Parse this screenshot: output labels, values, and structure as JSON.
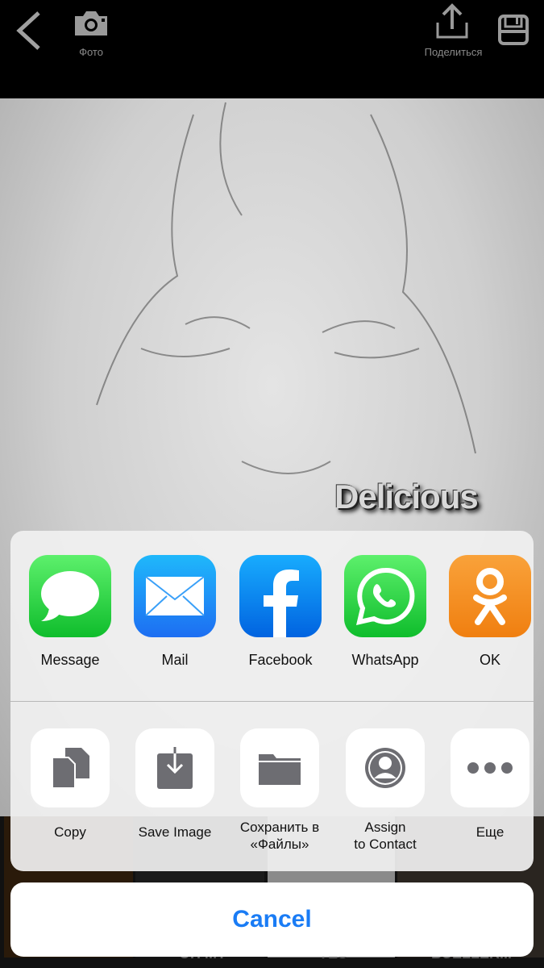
{
  "topbar": {
    "back_icon": "chevron-left-icon",
    "photo_label": "Фото",
    "share_label": "Поделиться",
    "save_icon": "floppy-disk-icon"
  },
  "photo": {
    "caption": "Delicious"
  },
  "thumbnails": [
    "OH MY",
    "YES",
    "BUELLER..."
  ],
  "share_sheet": {
    "apps": [
      {
        "label": "Message",
        "color": "#34c759"
      },
      {
        "label": "Mail",
        "color": "#1d8cf8"
      },
      {
        "label": "Facebook",
        "color": "#1877f2"
      },
      {
        "label": "WhatsApp",
        "color": "#25d366"
      },
      {
        "label": "OK",
        "color": "#f7931e"
      }
    ],
    "actions": [
      {
        "label": "Copy",
        "icon": "copy-icon"
      },
      {
        "label": "Save Image",
        "icon": "save-image-icon"
      },
      {
        "label": "Сохранить в\n«Файлы»",
        "icon": "folder-icon"
      },
      {
        "label": "Assign\nto Contact",
        "icon": "contact-icon"
      },
      {
        "label": "Еще",
        "icon": "more-icon"
      }
    ],
    "cancel_label": "Cancel"
  },
  "colors": {
    "accent": "#1a7cf5"
  }
}
